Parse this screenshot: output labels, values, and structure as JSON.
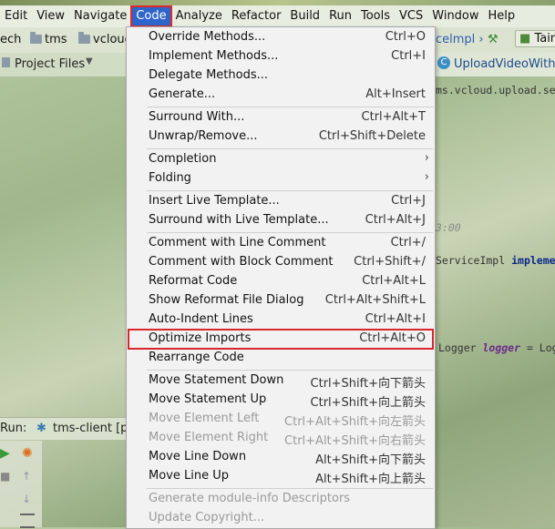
{
  "menubar": {
    "items": [
      "Edit",
      "View",
      "Navigate",
      "Code",
      "Analyze",
      "Refactor",
      "Build",
      "Run",
      "Tools",
      "VCS",
      "Window",
      "Help"
    ],
    "active": "Code"
  },
  "navbar": {
    "crumb1": "ech",
    "crumb2": "tms",
    "crumb3": "vcloud",
    "crumb_right": "celmpl",
    "run_config": "Tain"
  },
  "project_panel": {
    "label": "Project Files"
  },
  "editor": {
    "tab": "UploadVideoWithR",
    "line1": "ms.vcloud.upload.servic",
    "line2": "3:00",
    "line3_prefix": "ServiceImpl ",
    "line3_kw": "implement",
    "line4_prefix": "Logger ",
    "line4_var": "logger",
    "line4_suffix": " = Logge"
  },
  "runbar": {
    "label": "Run:",
    "config": "tms-client [pa"
  },
  "menu": {
    "items": [
      {
        "label": "Override Methods...",
        "shortcut": "Ctrl+O"
      },
      {
        "label": "Implement Methods...",
        "shortcut": "Ctrl+I"
      },
      {
        "label": "Delegate Methods...",
        "shortcut": ""
      },
      {
        "label": "Generate...",
        "shortcut": "Alt+Insert"
      },
      {
        "label": "Surround With...",
        "shortcut": "Ctrl+Alt+T"
      },
      {
        "label": "Unwrap/Remove...",
        "shortcut": "Ctrl+Shift+Delete"
      },
      {
        "label": "Completion",
        "shortcut": ""
      },
      {
        "label": "Folding",
        "shortcut": ""
      },
      {
        "label": "Insert Live Template...",
        "shortcut": "Ctrl+J"
      },
      {
        "label": "Surround with Live Template...",
        "shortcut": "Ctrl+Alt+J"
      },
      {
        "label": "Comment with Line Comment",
        "shortcut": "Ctrl+/"
      },
      {
        "label": "Comment with Block Comment",
        "shortcut": "Ctrl+Shift+/"
      },
      {
        "label": "Reformat Code",
        "shortcut": "Ctrl+Alt+L"
      },
      {
        "label": "Show Reformat File Dialog",
        "shortcut": "Ctrl+Alt+Shift+L"
      },
      {
        "label": "Auto-Indent Lines",
        "shortcut": "Ctrl+Alt+I"
      },
      {
        "label": "Optimize Imports",
        "shortcut": "Ctrl+Alt+O"
      },
      {
        "label": "Rearrange Code",
        "shortcut": ""
      },
      {
        "label": "Move Statement Down",
        "shortcut": "Ctrl+Shift+向下箭头"
      },
      {
        "label": "Move Statement Up",
        "shortcut": "Ctrl+Shift+向上箭头"
      },
      {
        "label": "Move Element Left",
        "shortcut": "Ctrl+Alt+Shift+向左箭头"
      },
      {
        "label": "Move Element Right",
        "shortcut": "Ctrl+Alt+Shift+向右箭头"
      },
      {
        "label": "Move Line Down",
        "shortcut": "Alt+Shift+向下箭头"
      },
      {
        "label": "Move Line Up",
        "shortcut": "Alt+Shift+向上箭头"
      },
      {
        "label": "Generate module-info Descriptors",
        "shortcut": ""
      },
      {
        "label": "Update Copyright...",
        "shortcut": ""
      }
    ]
  },
  "colors": {
    "menu_active_bg": "#2f65ca",
    "highlight_border": "#d9262b",
    "disabled_text": "#9a9a9a"
  }
}
